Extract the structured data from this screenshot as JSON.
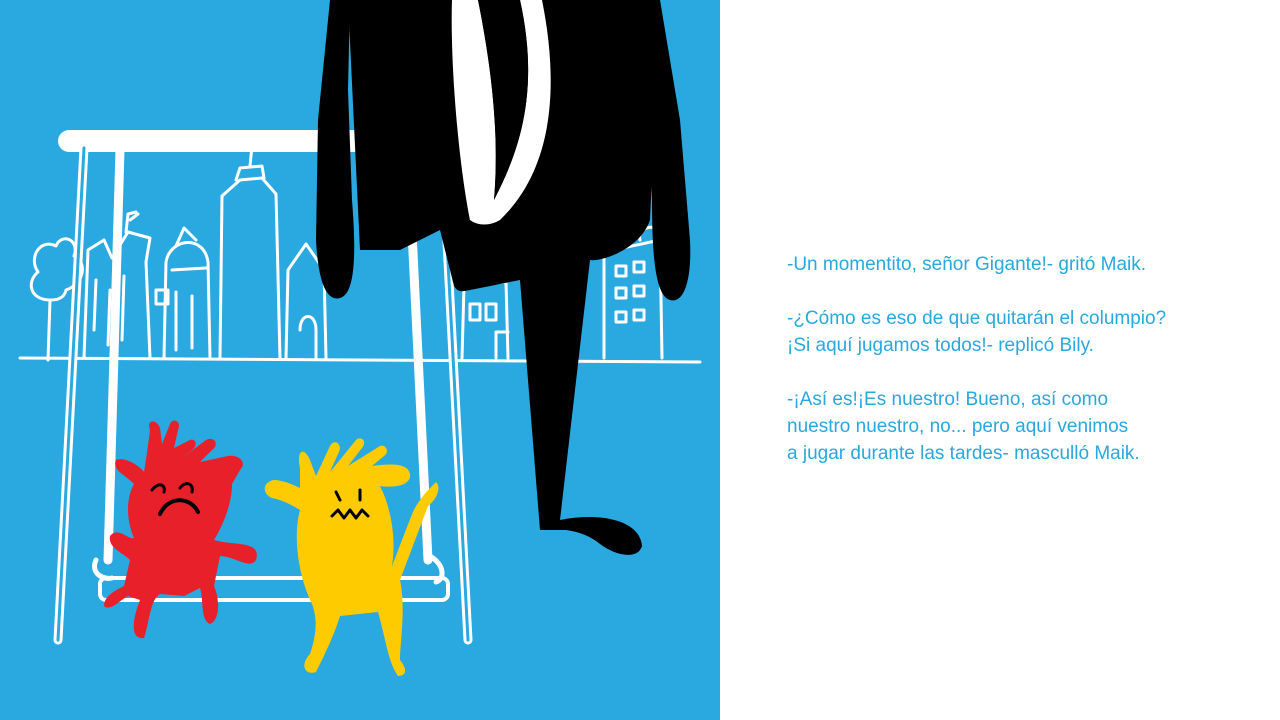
{
  "illustration": {
    "background_color": "#2aa8e0",
    "giant_color": "#000000",
    "red_monster_color": "#e8202a",
    "yellow_monster_color": "#fecb00",
    "line_color": "#ffffff"
  },
  "story": {
    "text_color": "#29a8df",
    "paragraphs": [
      {
        "lines": [
          "-Un momentito, señor Gigante!- gritó Maik."
        ]
      },
      {
        "lines": [
          "-¿Cómo es eso de que quitarán el columpio?",
          "¡Si aquí jugamos todos!- replicó Bily."
        ]
      },
      {
        "lines": [
          "-¡Así es!¡Es nuestro! Bueno, así como",
          "nuestro nuestro, no... pero aquí venimos",
          "a jugar durante las tardes- masculló Maik."
        ]
      }
    ]
  }
}
